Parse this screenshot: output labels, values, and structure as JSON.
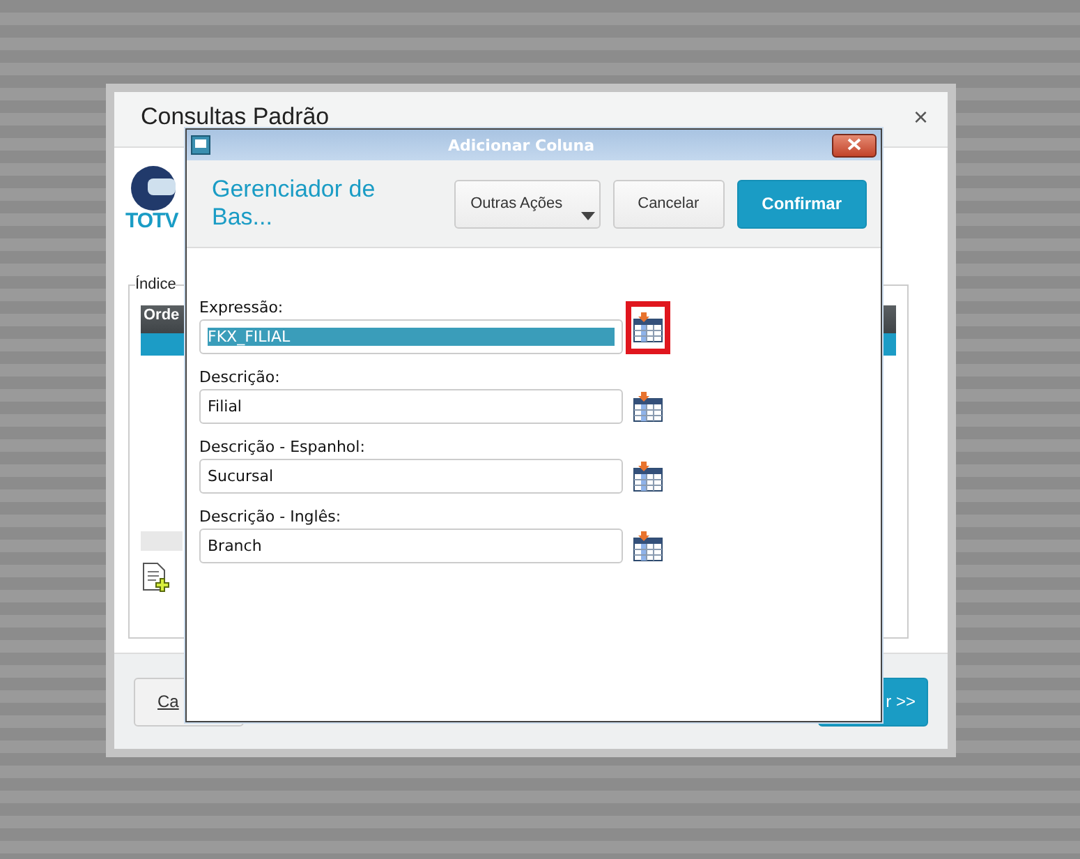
{
  "back_dialog": {
    "title": "Consultas Padrão",
    "close": "×",
    "logo_text": "TOTV",
    "group_label": "Índice",
    "table_header": "Orde",
    "footer_left": "Ca",
    "footer_right": "r >>"
  },
  "dialog": {
    "title": "Adicionar Coluna",
    "header_title": "Gerenciador de Bas...",
    "buttons": [
      {
        "label": "Outras Ações",
        "kind": "menu"
      },
      {
        "label": "Cancelar",
        "kind": "plain"
      },
      {
        "label": "Confirmar",
        "kind": "primary"
      }
    ],
    "fields": [
      {
        "label": "Expressão:",
        "value": "FKX_FILIAL",
        "selected": true,
        "highlighted": true
      },
      {
        "label": "Descrição:",
        "value": "Filial",
        "selected": false,
        "highlighted": false
      },
      {
        "label": "Descrição - Espanhol:",
        "value": "Sucursal",
        "selected": false,
        "highlighted": false
      },
      {
        "label": "Descrição - Inglês:",
        "value": "Branch",
        "selected": false,
        "highlighted": false
      }
    ]
  }
}
